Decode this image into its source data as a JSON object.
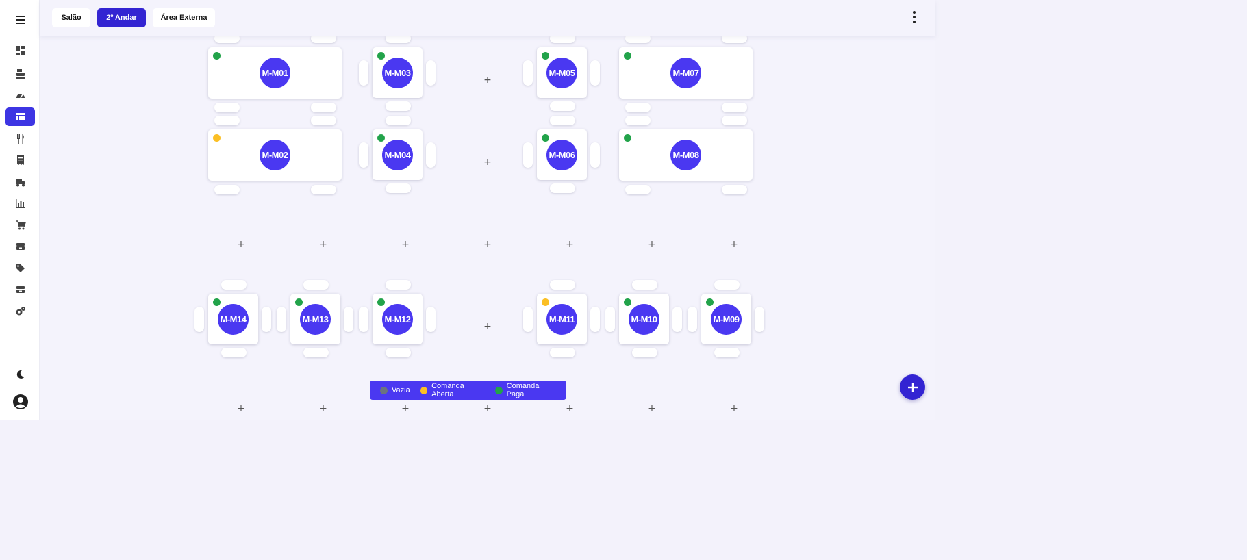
{
  "sidebar": {
    "items": [
      {
        "icon": "menu-icon"
      },
      {
        "icon": "dashboard-icon"
      },
      {
        "icon": "cash-register-icon"
      },
      {
        "icon": "speedometer-icon"
      },
      {
        "icon": "tables-grid-icon",
        "active": true
      },
      {
        "icon": "utensils-icon"
      },
      {
        "icon": "receipt-icon"
      },
      {
        "icon": "delivery-truck-icon"
      },
      {
        "icon": "bar-chart-icon"
      },
      {
        "icon": "cart-icon"
      },
      {
        "icon": "inventory-icon"
      },
      {
        "icon": "tags-icon"
      },
      {
        "icon": "boxes-icon"
      },
      {
        "icon": "settings-gears-icon"
      },
      {
        "icon": "moon-icon"
      },
      {
        "icon": "user-account-icon"
      }
    ]
  },
  "header": {
    "tabs": [
      {
        "label": "Salão",
        "active": false
      },
      {
        "label": "2º Andar",
        "active": true
      },
      {
        "label": "Área Externa",
        "active": false
      }
    ],
    "menu_icon": "more-vertical-icon"
  },
  "colors": {
    "accent": "#3d35e3",
    "table_circle": "#4a38f1",
    "status_empty": "#6b7280",
    "status_open": "#fbbf24",
    "status_paid": "#22a34a"
  },
  "tables": [
    {
      "label": "M-M01",
      "status": "paid"
    },
    {
      "label": "M-M03",
      "status": "paid"
    },
    {
      "label": "M-M05",
      "status": "paid"
    },
    {
      "label": "M-M07",
      "status": "paid"
    },
    {
      "label": "M-M02",
      "status": "open"
    },
    {
      "label": "M-M04",
      "status": "paid"
    },
    {
      "label": "M-M06",
      "status": "paid"
    },
    {
      "label": "M-M08",
      "status": "paid"
    },
    {
      "label": "M-M14",
      "status": "paid"
    },
    {
      "label": "M-M13",
      "status": "paid"
    },
    {
      "label": "M-M12",
      "status": "paid"
    },
    {
      "label": "M-M11",
      "status": "open"
    },
    {
      "label": "M-M10",
      "status": "paid"
    },
    {
      "label": "M-M09",
      "status": "paid"
    }
  ],
  "add_slot_symbol": "+",
  "legend": {
    "items": [
      {
        "label": "Vazia",
        "status": "empty"
      },
      {
        "label": "Comanda Aberta",
        "status": "open"
      },
      {
        "label": "Comanda Paga",
        "status": "paid"
      }
    ]
  },
  "fab": {
    "icon": "plus-icon"
  }
}
